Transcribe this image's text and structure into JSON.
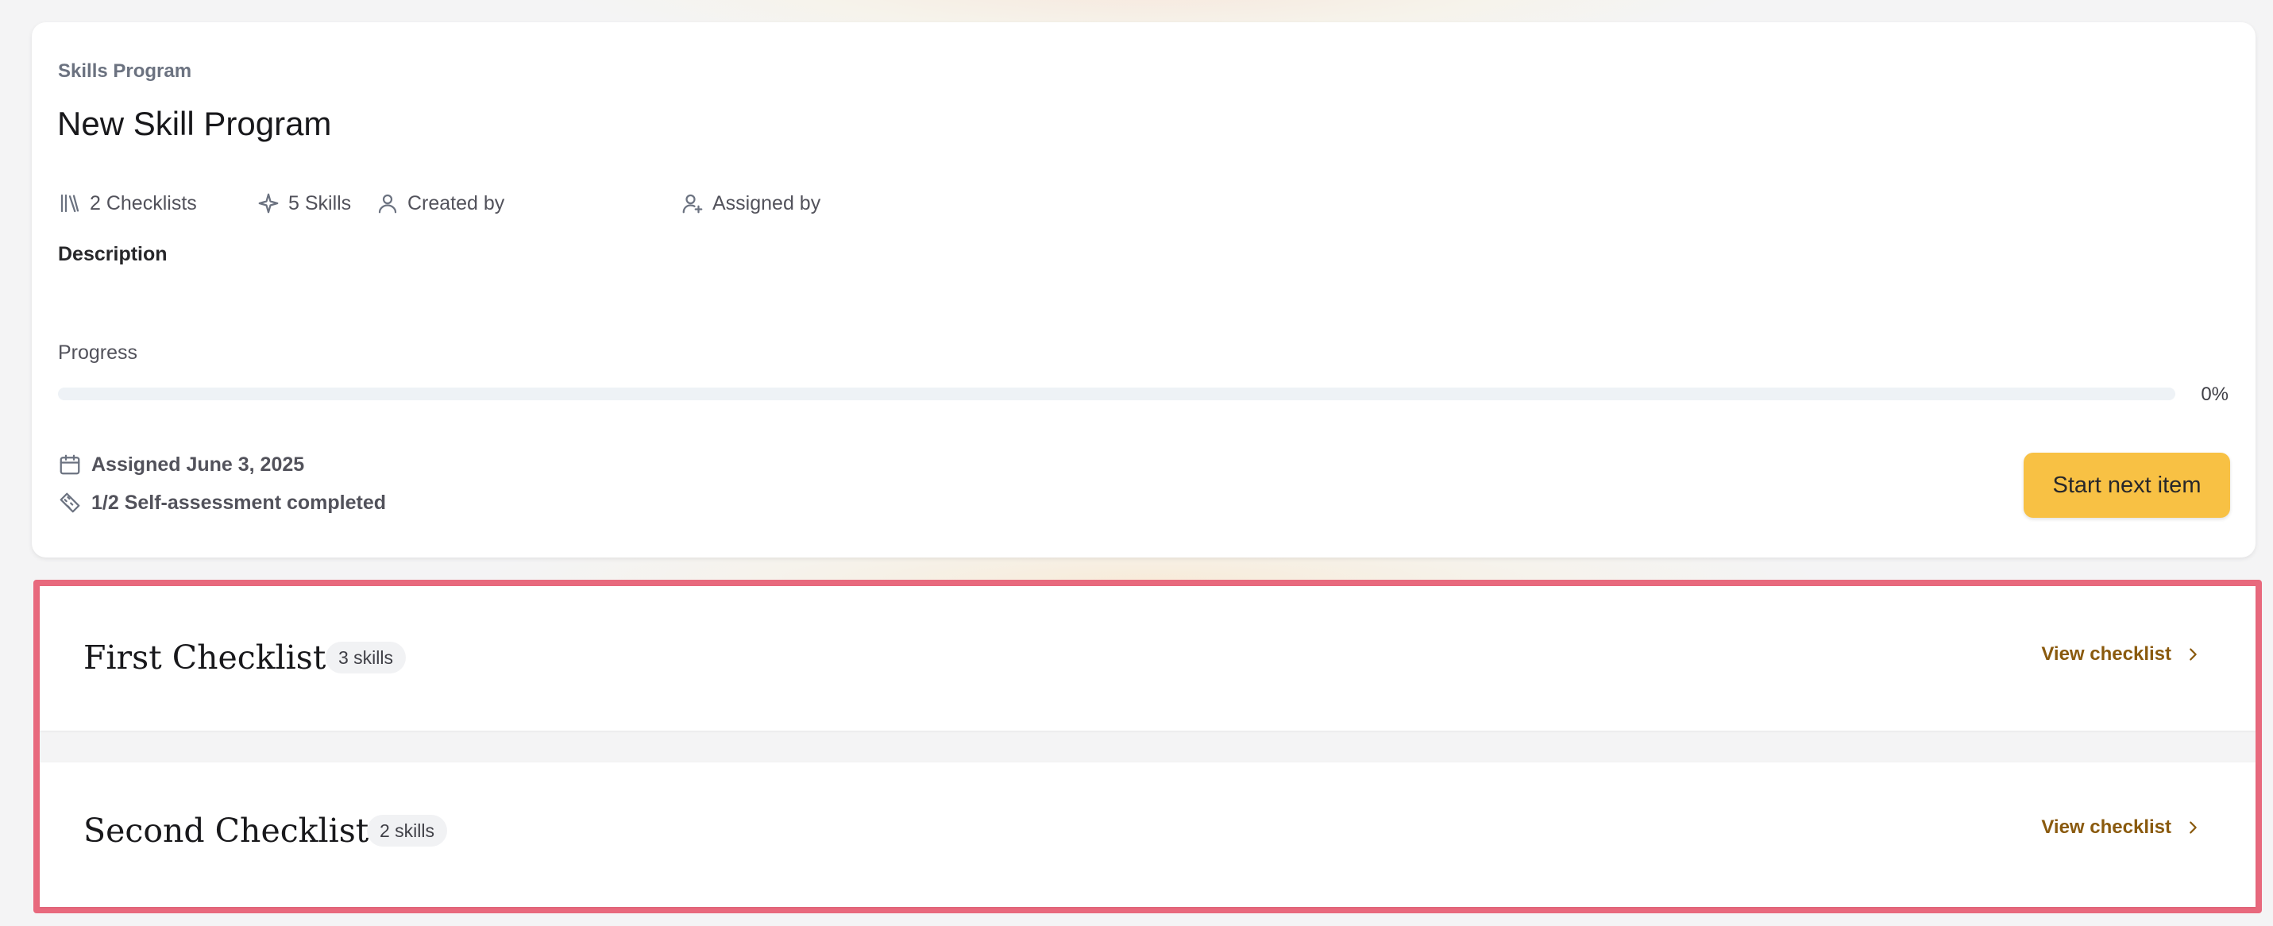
{
  "program": {
    "eyebrow": "Skills Program",
    "title": "New Skill Program",
    "meta": {
      "checklists": "2 Checklists",
      "skills": "5 Skills",
      "created_by": "Created by",
      "assigned_by": "Assigned by"
    },
    "description_label": "Description",
    "progress_label": "Progress",
    "progress_percent": "0%",
    "progress_value": 0,
    "assigned_date": "Assigned June 3, 2025",
    "self_assessment": "1/2 Self-assessment completed",
    "start_button": "Start next item"
  },
  "checklists": [
    {
      "title": "First Checklist",
      "badge": "3 skills",
      "link": "View checklist"
    },
    {
      "title": "Second Checklist",
      "badge": "2 skills",
      "link": "View checklist"
    }
  ],
  "colors": {
    "accent": "#f8c144",
    "link": "#8a5a0e",
    "highlight_border": "#e8697d"
  },
  "icons": [
    "books-icon",
    "sparkle-icon",
    "user-icon",
    "user-plus-icon",
    "calendar-icon",
    "tag-icon",
    "chevron-right-icon"
  ]
}
